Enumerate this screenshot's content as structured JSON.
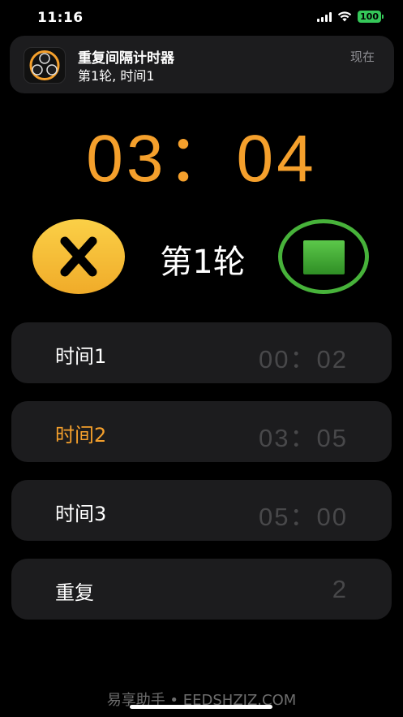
{
  "status_bar": {
    "time": "11:16",
    "battery": "100"
  },
  "notification": {
    "title": "重复间隔计时器",
    "body": "第1轮, 时间1",
    "time": "现在"
  },
  "timer": {
    "display": "03：04",
    "color": "#f5a02c"
  },
  "controls": {
    "round_label": "第1轮",
    "cancel_icon": "close-icon",
    "stop_icon": "stop-square-icon"
  },
  "rows": [
    {
      "label": "时间1",
      "value": "00：02",
      "active": false
    },
    {
      "label": "时间2",
      "value": "03：05",
      "active": true
    },
    {
      "label": "时间3",
      "value": "05：00",
      "active": false
    },
    {
      "label": "重复",
      "value": "2",
      "active": false
    }
  ],
  "watermark": "易享助手 • EEDSHZJZ.COM"
}
